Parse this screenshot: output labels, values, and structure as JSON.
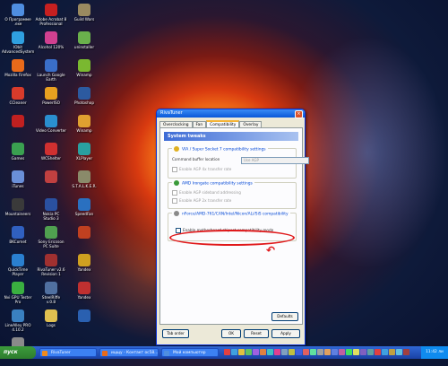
{
  "desktop": {
    "icons": [
      {
        "label": "О Программе\n.exe",
        "color": "#4f8ee0",
        "icon": "computer-icon"
      },
      {
        "label": "Adobe Acrobat 8\nProfessional",
        "color": "#c62020",
        "icon": "acrobat-icon"
      },
      {
        "label": "Guild Wars",
        "color": "#9a8a60",
        "icon": "game-icon"
      },
      {
        "label": "IObit\nAdvancedSystem",
        "color": "#2fa0e0",
        "icon": "iobit-icon"
      },
      {
        "label": "Alcohol 120%",
        "color": "#d04090",
        "icon": "alcohol-icon"
      },
      {
        "label": "uninstaller",
        "color": "#6ab04c",
        "icon": "uninstall-icon"
      },
      {
        "label": "Mozilla Firefox",
        "color": "#e86a1a",
        "icon": "firefox-icon"
      },
      {
        "label": "Launch Google\nEarth",
        "color": "#3a6ec8",
        "icon": "earth-icon"
      },
      {
        "label": "Winamp",
        "color": "#7ab830",
        "icon": "winamp-icon"
      },
      {
        "label": "CCleaner",
        "color": "#d83b2b",
        "icon": "ccleaner-icon"
      },
      {
        "label": "PowerISO",
        "color": "#e8a020",
        "icon": "poweriso-icon"
      },
      {
        "label": "Photoshop",
        "color": "#2c5aa0",
        "icon": "photoshop-icon"
      },
      {
        "label": "",
        "color": "#c02020",
        "icon": "app-icon"
      },
      {
        "label": "Video Converter",
        "color": "#2a8fd0",
        "icon": "video-icon"
      },
      {
        "label": "Winamp",
        "color": "#e0a030",
        "icon": "winamp-icon"
      },
      {
        "label": "Games",
        "color": "#3aa050",
        "icon": "games-icon"
      },
      {
        "label": "WCShelter",
        "color": "#d03030",
        "icon": "wc-icon"
      },
      {
        "label": "XLPlayer",
        "color": "#2aa0a0",
        "icon": "player-icon"
      },
      {
        "label": "iTunes",
        "color": "#6a8fd8",
        "icon": "itunes-icon"
      },
      {
        "label": "",
        "color": "#c04040",
        "icon": "app-icon"
      },
      {
        "label": "S.T.A.L.K.E.R.",
        "color": "#8a8a6a",
        "icon": "game-icon"
      },
      {
        "label": "Mountaineers",
        "color": "#3a3a3a",
        "icon": "app-icon"
      },
      {
        "label": "Nokia PC\nStudio 3",
        "color": "#2a50a0",
        "icon": "nokia-icon"
      },
      {
        "label": "SpeedFan",
        "color": "#2a70c0",
        "icon": "fan-icon"
      },
      {
        "label": "BKComet",
        "color": "#3060c0",
        "icon": "app-icon"
      },
      {
        "label": "Sony Ericsson\nPC Suite",
        "color": "#50a050",
        "icon": "phone-icon"
      },
      {
        "label": "",
        "color": "#c04020",
        "icon": "app-icon"
      },
      {
        "label": "QuickTime Player",
        "color": "#2a80d0",
        "icon": "quicktime-icon"
      },
      {
        "label": "RivaTuner v2.6\nRevision 1",
        "color": "#a03030",
        "icon": "rivatuner-icon"
      },
      {
        "label": "Yandex",
        "color": "#d0a020",
        "icon": "app-icon"
      },
      {
        "label": "Nvi GPU Tester\nPro",
        "color": "#3ab040",
        "icon": "gpu-icon"
      },
      {
        "label": "SteelRiffe\nv.0.8",
        "color": "#5070a0",
        "icon": "app-icon"
      },
      {
        "label": "Yandex",
        "color": "#c03030",
        "icon": "app-icon"
      },
      {
        "label": "LineAlley PRO\n4.10.2",
        "color": "#3a80c0",
        "icon": "app-icon"
      },
      {
        "label": "Logs",
        "color": "#e0c050",
        "icon": "folder-icon"
      },
      {
        "label": "",
        "color": "#2a60b0",
        "icon": "app-icon"
      },
      {
        "label": "Nmap/02",
        "color": "#8a8a8a",
        "icon": "app-icon"
      }
    ]
  },
  "window": {
    "title": "RivaTuner",
    "tabs": [
      "Overclocking",
      "Fan",
      "Compatibility",
      "Overlay"
    ],
    "active_tab": 2,
    "header": "System tweaks",
    "groups": [
      {
        "title": "VIA / Super Socket 7 compatibility settings",
        "command_buffer_label": "Command buffer location",
        "command_buffer_value": "Use AGP",
        "checkbox": "Enable AGP 4x transfer rate"
      },
      {
        "title": "AMD Irongate compatibility settings",
        "checkboxes": [
          "Enable AGP sideband addressing",
          "Enable AGP 2x transfer rate"
        ]
      },
      {
        "title": "nForce/AMD-761/CAN/Intel/Nicon/ALi/SiS compatibility",
        "checkbox": "Enable motherboard chipset compatibility mode"
      }
    ],
    "defaults_button": "Defaults",
    "bottom_buttons": [
      "Tab order",
      "OK",
      "Reset",
      "Apply"
    ]
  },
  "taskbar": {
    "start_label": "пуск",
    "tasks": [
      "RivaTuner",
      "ицщу - Контакт ос58...",
      "Мой компьютер"
    ],
    "clock": "11:42 ли"
  },
  "colors": {
    "highlight": "#e0181a",
    "title_blue": "#0a58d8"
  }
}
